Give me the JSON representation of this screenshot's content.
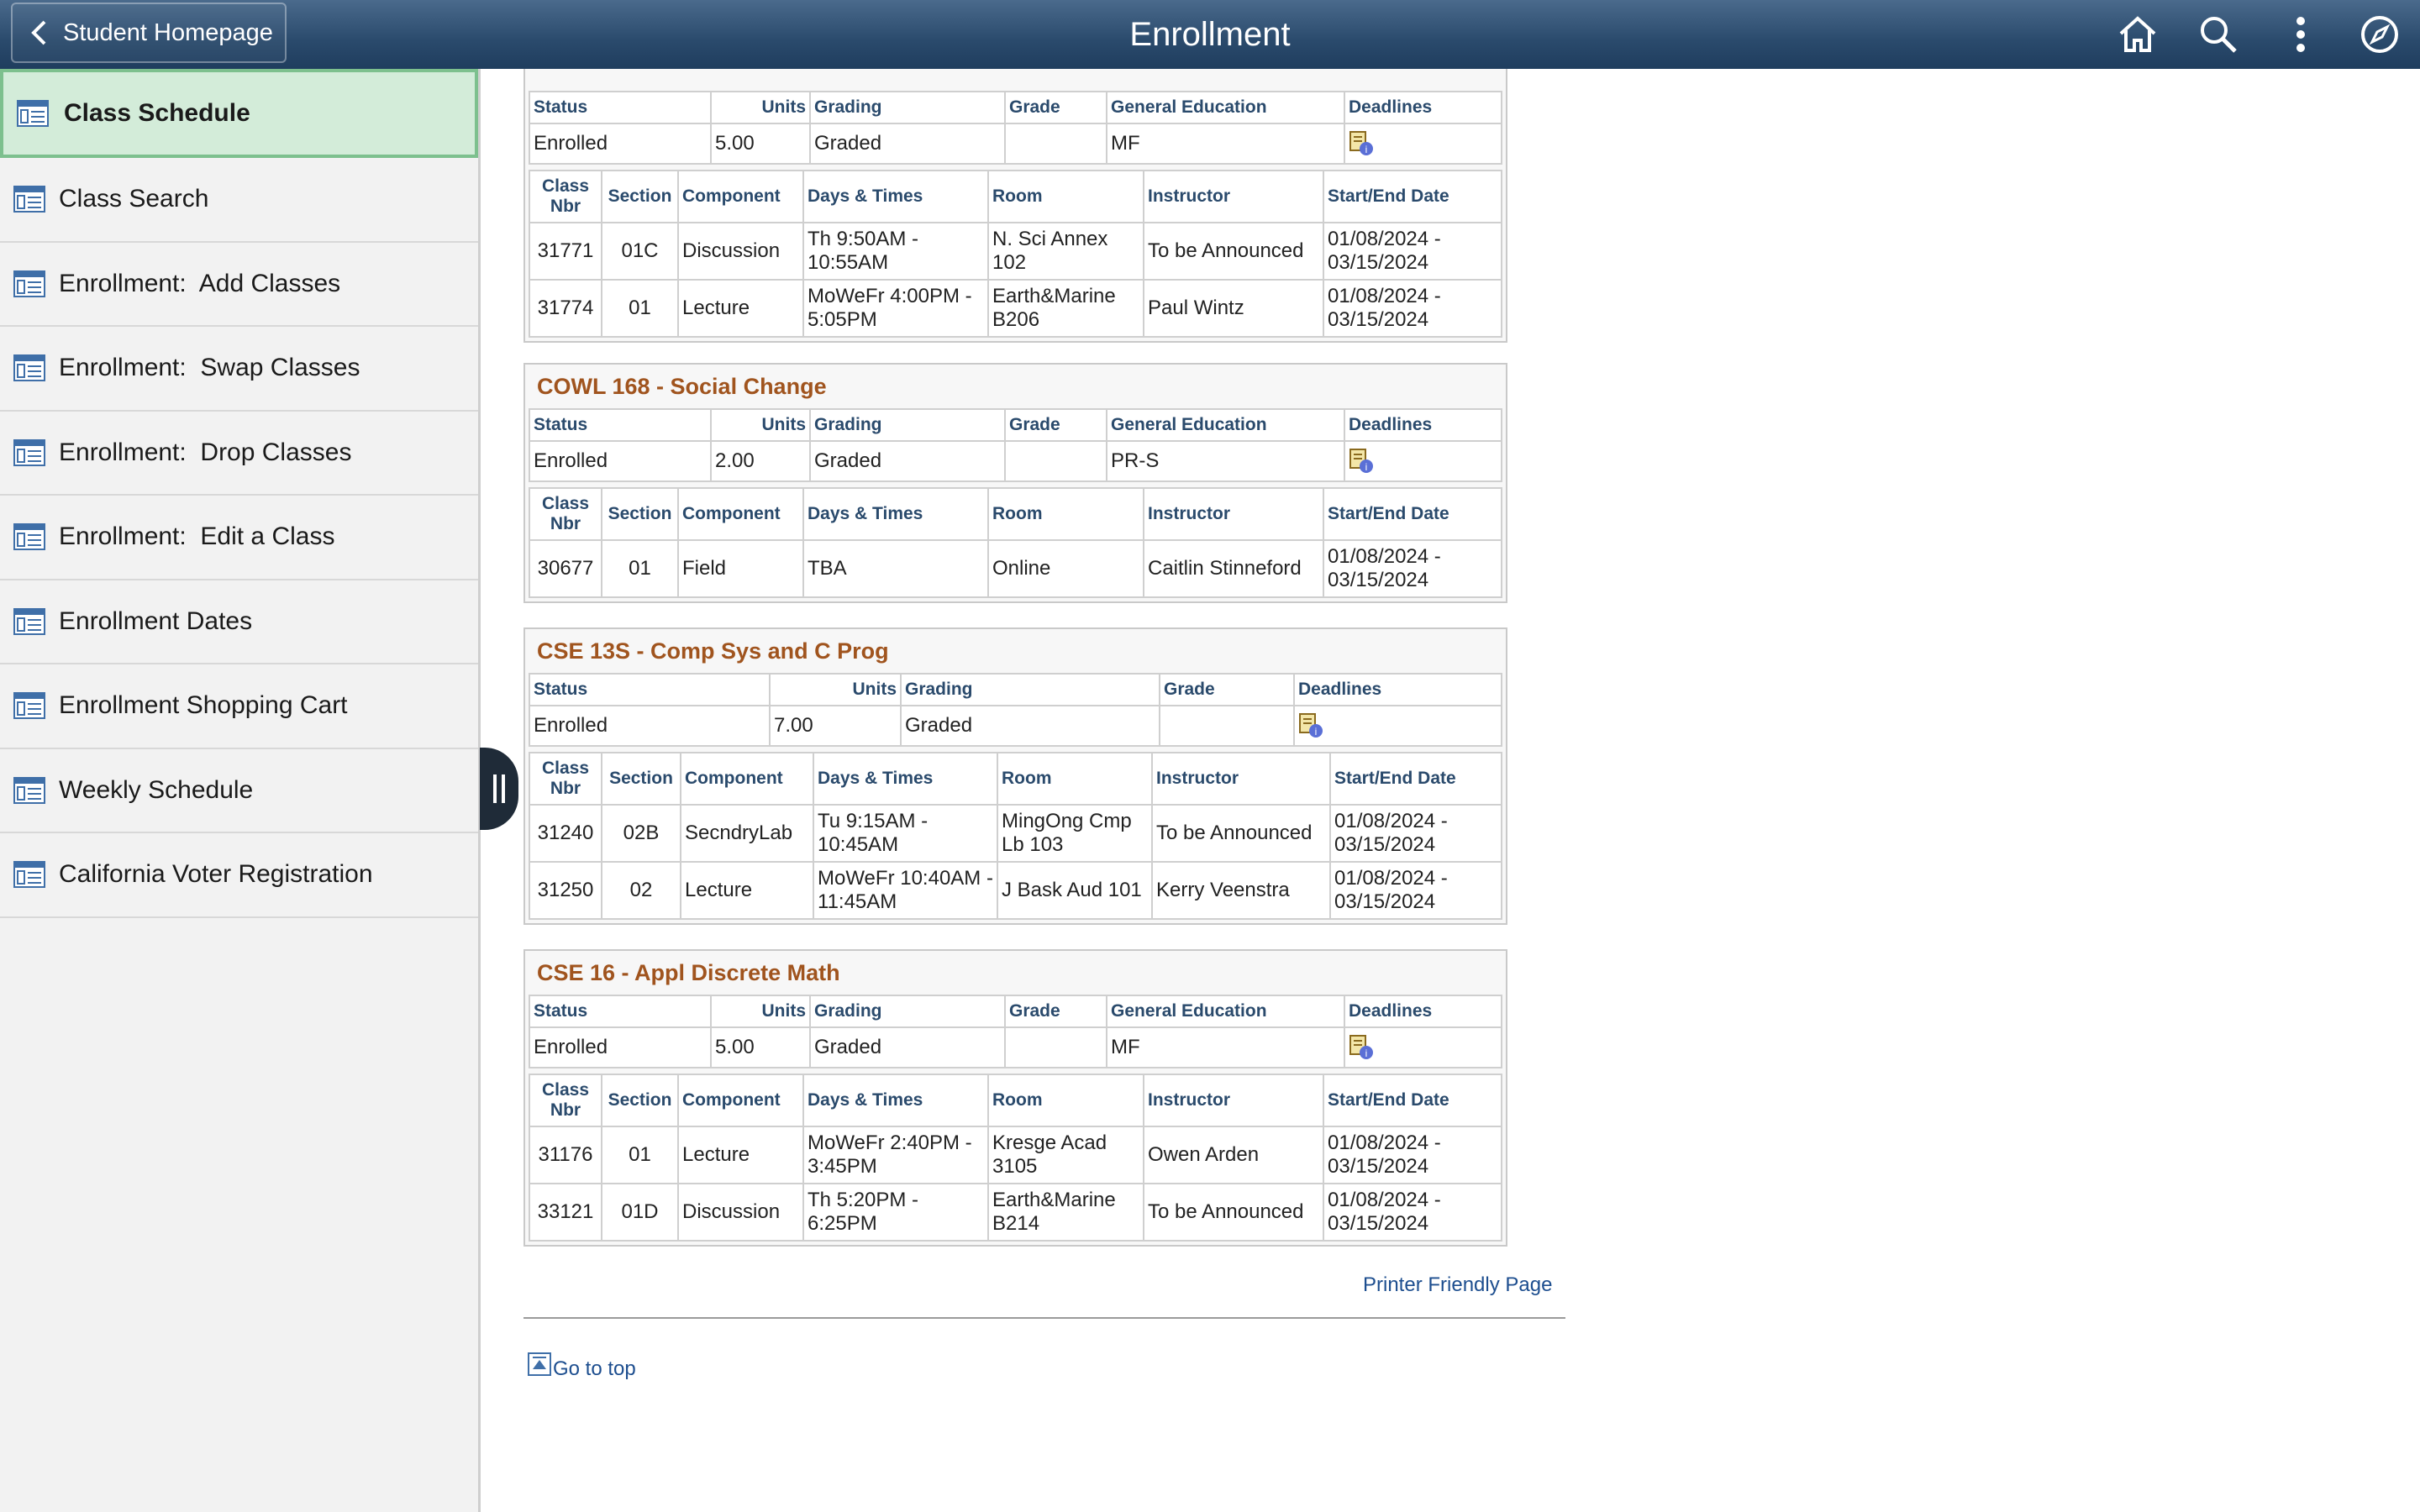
{
  "header": {
    "back_label": "Student Homepage",
    "title": "Enrollment",
    "icons": [
      "home-icon",
      "search-icon",
      "more-vertical-icon",
      "compass-icon"
    ]
  },
  "sidebar": {
    "items": [
      {
        "label": "Class Schedule",
        "active": true
      },
      {
        "label": "Class Search"
      },
      {
        "label": "Enrollment:  Add Classes"
      },
      {
        "label": "Enrollment:  Swap Classes"
      },
      {
        "label": "Enrollment:  Drop Classes"
      },
      {
        "label": "Enrollment:  Edit a Class"
      },
      {
        "label": "Enrollment Dates"
      },
      {
        "label": "Enrollment Shopping Cart"
      },
      {
        "label": "Weekly Schedule"
      },
      {
        "label": "California Voter Registration"
      }
    ]
  },
  "headers": {
    "status": "Status",
    "units": "Units",
    "grading": "Grading",
    "grade": "Grade",
    "gen_ed": "General Education",
    "deadlines": "Deadlines",
    "class_nbr": "Class Nbr",
    "section": "Section",
    "component": "Component",
    "days_times": "Days & Times",
    "room": "Room",
    "instructor": "Instructor",
    "start_end": "Start/End Date"
  },
  "courses": [
    {
      "title": "",
      "status": "Enrolled",
      "units": "5.00",
      "grading": "Graded",
      "grade": "",
      "gen_ed": "MF",
      "sections": [
        {
          "nbr": "31771",
          "section": "01C",
          "component": "Discussion",
          "days": "Th 9:50AM - 10:55AM",
          "room": "N. Sci Annex 102",
          "instructor": "To be Announced",
          "dates": "01/08/2024 - 03/15/2024"
        },
        {
          "nbr": "31774",
          "section": "01",
          "component": "Lecture",
          "days": "MoWeFr 4:00PM - 5:05PM",
          "room": "Earth&Marine B206",
          "instructor": "Paul Wintz",
          "dates": "01/08/2024 - 03/15/2024"
        }
      ]
    },
    {
      "title": "COWL 168 - Social Change",
      "status": "Enrolled",
      "units": "2.00",
      "grading": "Graded",
      "grade": "",
      "gen_ed": "PR-S",
      "sections": [
        {
          "nbr": "30677",
          "section": "01",
          "component": "Field",
          "days": "TBA",
          "room": "Online",
          "instructor": "Caitlin Stinneford",
          "dates": "01/08/2024 - 03/15/2024"
        }
      ]
    },
    {
      "title": "CSE 13S - Comp Sys and C Prog",
      "status": "Enrolled",
      "units": "7.00",
      "grading": "Graded",
      "grade": "",
      "sections": [
        {
          "nbr": "31240",
          "section": "02B",
          "component": "SecndryLab",
          "days": "Tu 9:15AM - 10:45AM",
          "room": "MingOng Cmp Lb 103",
          "instructor": "To be Announced",
          "dates": "01/08/2024 - 03/15/2024"
        },
        {
          "nbr": "31250",
          "section": "02",
          "component": "Lecture",
          "days": "MoWeFr 10:40AM - 11:45AM",
          "room": "J Bask Aud 101",
          "instructor": "Kerry Veenstra",
          "dates": "01/08/2024 - 03/15/2024"
        }
      ]
    },
    {
      "title": "CSE 16 - Appl Discrete Math",
      "status": "Enrolled",
      "units": "5.00",
      "grading": "Graded",
      "grade": "",
      "gen_ed": "MF",
      "sections": [
        {
          "nbr": "31176",
          "section": "01",
          "component": "Lecture",
          "days": "MoWeFr 2:40PM - 3:45PM",
          "room": "Kresge Acad 3105",
          "instructor": "Owen Arden",
          "dates": "01/08/2024 - 03/15/2024"
        },
        {
          "nbr": "33121",
          "section": "01D",
          "component": "Discussion",
          "days": "Th 5:20PM - 6:25PM",
          "room": "Earth&Marine B214",
          "instructor": "To be Announced",
          "dates": "01/08/2024 - 03/15/2024"
        }
      ]
    }
  ],
  "footer": {
    "printer_label": "Printer Friendly Page",
    "go_top_label": "Go to top"
  },
  "colors": {
    "header_bg": "#2a4a6c",
    "course_title": "#a0541e",
    "link": "#1d4e8f",
    "active_nav": "#d3ecd9"
  }
}
